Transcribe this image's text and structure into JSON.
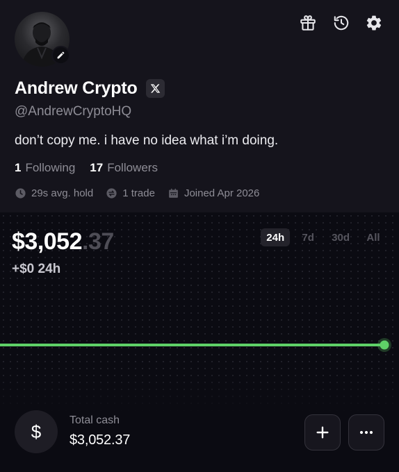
{
  "profile": {
    "name": "Andrew Crypto",
    "handle": "@AndrewCryptoHQ",
    "bio": "don’t copy me. i have no idea what i’m doing.",
    "following_count": "1",
    "following_label": "Following",
    "followers_count": "17",
    "followers_label": "Followers",
    "stats": {
      "avg_hold": "29s avg. hold",
      "trades": "1 trade",
      "joined": "Joined Apr 2026"
    }
  },
  "header_icons": [
    "gift-icon",
    "history-icon",
    "settings-icon"
  ],
  "portfolio": {
    "balance_main": "$3,052",
    "balance_cents": ".37",
    "change": "+$0 24h",
    "ranges": [
      "24h",
      "7d",
      "30d",
      "All"
    ],
    "active_range": "24h",
    "line_color": "#5fd068"
  },
  "cash": {
    "symbol": "$",
    "label": "Total cash",
    "value": "$3,052.37"
  },
  "colors": {
    "accent_green": "#5fd068",
    "profile_bg": "#15141c",
    "page_bg": "#0b0b12",
    "muted_text": "#8e8d96"
  }
}
